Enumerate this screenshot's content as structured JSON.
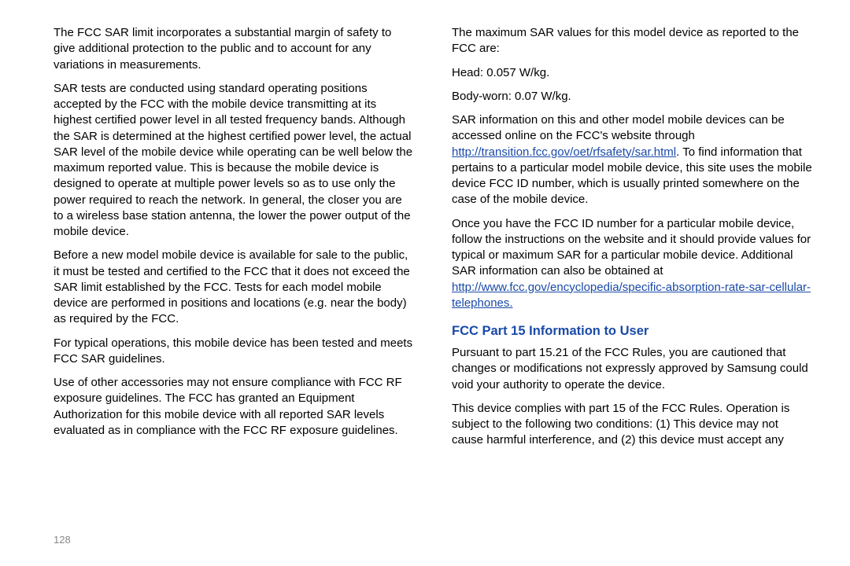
{
  "pageNumber": "128",
  "left": {
    "p1": "The FCC SAR limit incorporates a substantial margin of safety to give additional protection to the public and to account for any variations in measurements.",
    "p2": "SAR tests are conducted using standard operating positions accepted by the FCC with the mobile device transmitting at its highest certified power level in all tested frequency bands. Although the SAR is determined at the highest certified power level, the actual SAR level of the mobile device while operating can be well below the maximum reported value. This is because the mobile device is designed to operate at multiple power levels so as to use only the power required to reach the network. In general, the closer you are to a wireless base station antenna, the lower the power output of the mobile device.",
    "p3": "Before a new model mobile device is available for sale to the public, it must be tested and certified to the FCC that it does not exceed the SAR limit established by the FCC. Tests for each model mobile device are performed in positions and locations (e.g. near the body) as required by the FCC.",
    "p4": "For typical operations, this mobile device has been tested and meets FCC SAR guidelines.",
    "p5": "Use of other accessories may not ensure compliance with FCC RF exposure guidelines. The FCC has granted an Equipment Authorization for this mobile device with all reported SAR levels evaluated as in compliance with the FCC RF exposure guidelines."
  },
  "right": {
    "p1": "The maximum SAR values for this model device as reported to the FCC are:",
    "p2": "Head: 0.057 W/kg.",
    "p3": "Body-worn: 0.07 W/kg.",
    "p4_pre": "SAR information on this and other model mobile devices can be accessed online on the FCC's website through ",
    "p4_link": "http://transition.fcc.gov/oet/rfsafety/sar.html",
    "p4_post": ". To find information that pertains to a particular model mobile device, this site uses the mobile device FCC ID number, which is usually printed somewhere on the case of the mobile device.",
    "p5": "Once you have the FCC ID number for a particular mobile device, follow the instructions on the website and it should provide values for typical or maximum SAR for a particular mobile device. Additional SAR information can also be obtained at ",
    "p5_link": "http://www.fcc.gov/encyclopedia/specific-absorption-rate-sar-cellular-telephones.",
    "heading": "FCC Part 15 Information to User",
    "p6": "Pursuant to part 15.21 of the FCC Rules, you are cautioned that changes or modifications not expressly approved by Samsung could void your authority to operate the device.",
    "p7": "This device complies with part 15 of the FCC Rules. Operation is subject to the following two conditions: (1) This device may not cause harmful interference, and (2) this device must accept any"
  }
}
